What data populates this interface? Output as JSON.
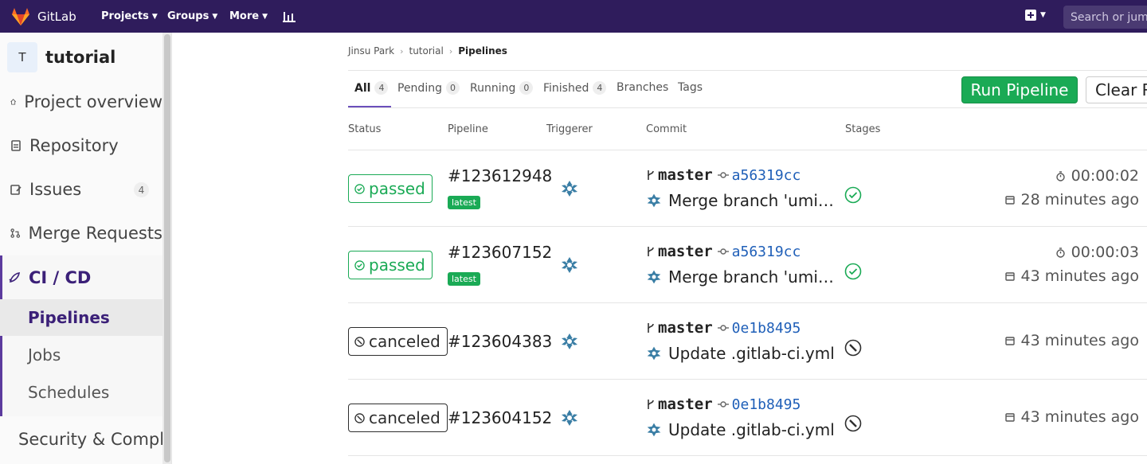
{
  "topbar": {
    "logo_text": "GitLab",
    "nav": [
      {
        "label": "Projects"
      },
      {
        "label": "Groups"
      },
      {
        "label": "More"
      }
    ],
    "search_placeholder": "Search or jump to…",
    "colors": {
      "bg": "#2f1c5c",
      "accent": "#fc6d26"
    }
  },
  "sidebar": {
    "project_initial": "T",
    "project_name": "tutorial",
    "items": [
      {
        "label": "Project overview",
        "icon": "home-icon"
      },
      {
        "label": "Repository",
        "icon": "doc-icon"
      },
      {
        "label": "Issues",
        "icon": "issues-icon",
        "badge": "4"
      },
      {
        "label": "Merge Requests",
        "icon": "merge-request-icon"
      },
      {
        "label": "CI / CD",
        "icon": "rocket-icon",
        "active": true
      },
      {
        "label": "Security & Compliance",
        "icon": "shield-icon"
      }
    ],
    "cicd_sub": [
      {
        "label": "Pipelines",
        "active": true
      },
      {
        "label": "Jobs"
      },
      {
        "label": "Schedules"
      }
    ]
  },
  "breadcrumb": {
    "items": [
      "Jinsu Park",
      "tutorial",
      "Pipelines"
    ]
  },
  "tabs": [
    {
      "label": "All",
      "count": "4",
      "active": true
    },
    {
      "label": "Pending",
      "count": "0"
    },
    {
      "label": "Running",
      "count": "0"
    },
    {
      "label": "Finished",
      "count": "4"
    },
    {
      "label": "Branches"
    },
    {
      "label": "Tags"
    }
  ],
  "buttons": {
    "run_pipeline": "Run Pipeline",
    "clear": "Clear Runner Caches"
  },
  "table": {
    "headers": [
      "Status",
      "Pipeline",
      "Triggerer",
      "Commit",
      "Stages"
    ],
    "rows": [
      {
        "status": "passed",
        "id": "#123612948",
        "latest": "latest",
        "branch": "master",
        "sha": "a56319cc",
        "message": "Merge branch 'umi…",
        "stage": "passed",
        "duration": "00:00:02",
        "finished": "28 minutes ago"
      },
      {
        "status": "passed",
        "id": "#123607152",
        "latest": "latest",
        "branch": "master",
        "sha": "a56319cc",
        "message": "Merge branch 'umi…",
        "stage": "passed",
        "duration": "00:00:03",
        "finished": "43 minutes ago"
      },
      {
        "status": "canceled",
        "id": "#123604383",
        "branch": "master",
        "sha": "0e1b8495",
        "message": "Update .gitlab-ci.yml",
        "stage": "canceled",
        "finished": "43 minutes ago"
      },
      {
        "status": "canceled",
        "id": "#123604152",
        "branch": "master",
        "sha": "0e1b8495",
        "message": "Update .gitlab-ci.yml",
        "stage": "canceled",
        "finished": "43 minutes ago"
      }
    ]
  }
}
